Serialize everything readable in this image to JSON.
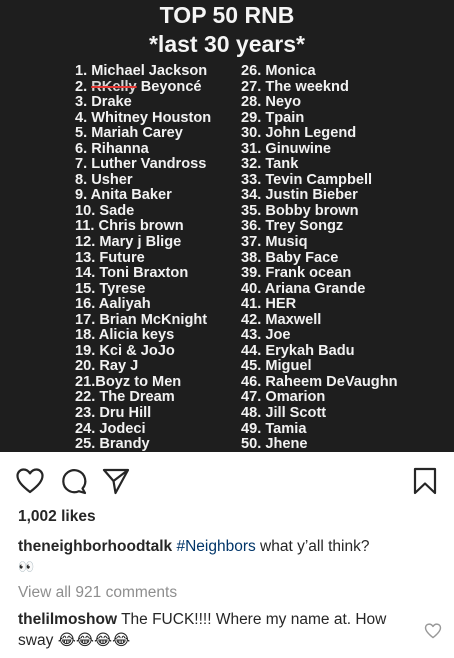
{
  "post_image": {
    "title_line1": "TOP 50 RNB",
    "title_line2": "*last 30 years*",
    "left_column": [
      "1. Michael Jackson",
      "2.",
      "3. Drake",
      "4. Whitney Houston",
      "5. Mariah Carey",
      "6. Rihanna",
      "7. Luther Vandross",
      "8. Usher",
      "9. Anita Baker",
      "10. Sade",
      "11. Chris brown",
      "12. Mary j Blige",
      "13. Future",
      "14. Toni Braxton",
      "15. Tyrese",
      "16. Aaliyah",
      "17. Brian McKnight",
      "18. Alicia keys",
      "19. Kci & JoJo",
      "20. Ray J",
      "21.Boyz to Men",
      "22. The Dream",
      "23. Dru Hill",
      "24. Jodeci",
      "25. Brandy"
    ],
    "struck_name": "RKelly",
    "replacement_name": "Beyoncé",
    "right_column": [
      "26. Monica",
      "27. The weeknd",
      "28. Neyo",
      "29. Tpain",
      "30. John Legend",
      "31. Ginuwine",
      "32. Tank",
      "33. Tevin Campbell",
      "34. Justin Bieber",
      "35. Bobby brown",
      "36. Trey Songz",
      "37. Musiq",
      "38. Baby Face",
      "39. Frank ocean",
      "40. Ariana Grande",
      "41. HER",
      "42. Maxwell",
      "43. Joe",
      "44. Erykah Badu",
      "45. Miguel",
      "46. Raheem DeVaughn",
      "47. Omarion",
      "48. Jill Scott",
      "49. Tamia",
      "50. Jhene"
    ]
  },
  "actions": {
    "icons": [
      "heart-icon",
      "comment-icon",
      "share-icon",
      "bookmark-icon"
    ]
  },
  "likes_text": "1,002 likes",
  "caption": {
    "username": "theneighborhoodtalk",
    "hashtag": "#Neighbors",
    "text": " what y’all think?",
    "emoji": "👀"
  },
  "view_all_comments": "View all 921 comments",
  "comment": {
    "username": "thelilmoshow",
    "text": " The FUCK!!!! Where my name at. How sway ",
    "emoji": "😂😂😂😂"
  },
  "colors": {
    "image_background": "#1e1e1e",
    "hashtag": "#003569",
    "muted": "#8e8e8e",
    "strike": "#e53935"
  }
}
